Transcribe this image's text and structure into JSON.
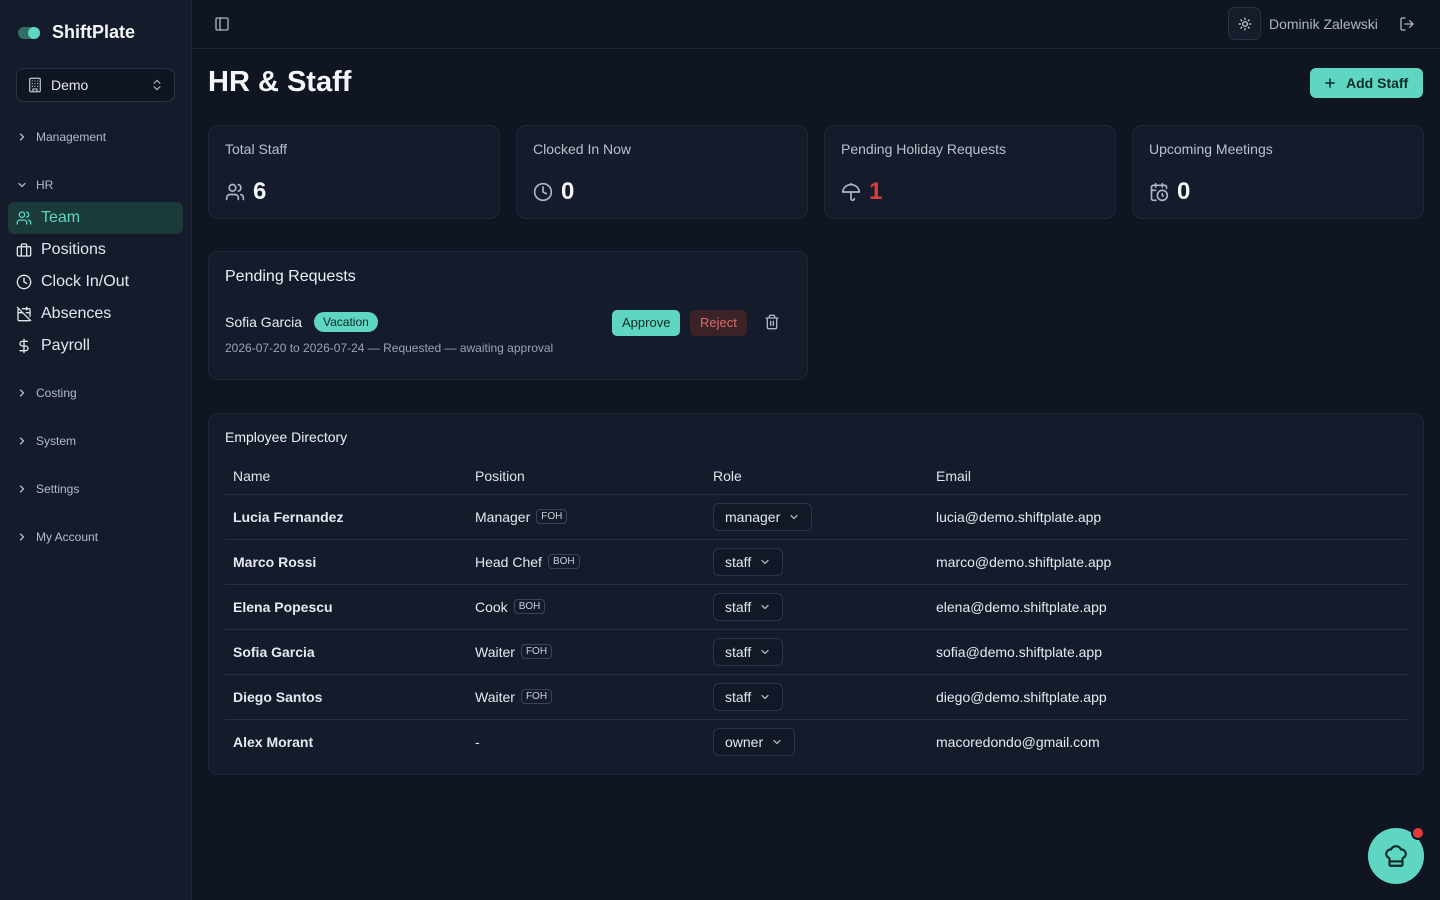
{
  "app": {
    "name": "ShiftPlate"
  },
  "org_select": {
    "value": "Demo"
  },
  "sidebar": {
    "groups": [
      {
        "label": "Management",
        "expanded": false
      },
      {
        "label": "HR",
        "expanded": true
      },
      {
        "label": "Costing",
        "expanded": false
      },
      {
        "label": "System",
        "expanded": false
      },
      {
        "label": "Settings",
        "expanded": false
      },
      {
        "label": "My Account",
        "expanded": false
      }
    ],
    "hr_items": [
      {
        "label": "Team",
        "icon": "users-icon",
        "active": true
      },
      {
        "label": "Positions",
        "icon": "briefcase-icon"
      },
      {
        "label": "Clock In/Out",
        "icon": "clock-icon"
      },
      {
        "label": "Absences",
        "icon": "calendar-off-icon"
      },
      {
        "label": "Payroll",
        "icon": "dollar-icon"
      }
    ]
  },
  "topbar": {
    "user_name": "Dominik Zalewski"
  },
  "page": {
    "title": "HR & Staff",
    "add_button": "Add Staff"
  },
  "stats": [
    {
      "title": "Total Staff",
      "value": "6",
      "icon": "users-icon"
    },
    {
      "title": "Clocked In Now",
      "value": "0",
      "icon": "clock-icon"
    },
    {
      "title": "Pending Holiday Requests",
      "value": "1",
      "icon": "umbrella-icon",
      "color": "#e03b3b"
    },
    {
      "title": "Upcoming Meetings",
      "value": "0",
      "icon": "calendar-clock-icon"
    }
  ],
  "pending": {
    "title": "Pending Requests",
    "request": {
      "name": "Sofia Garcia",
      "type": "Vacation",
      "meta": "2026-07-20 to 2026-07-24 — Requested — awaiting approval",
      "approve": "Approve",
      "reject": "Reject"
    }
  },
  "directory": {
    "title": "Employee Directory",
    "columns": [
      "Name",
      "Position",
      "Role",
      "Email"
    ],
    "rows": [
      {
        "name": "Lucia Fernandez",
        "position": "Manager",
        "tag": "FOH",
        "role": "manager",
        "email": "lucia@demo.shiftplate.app"
      },
      {
        "name": "Marco Rossi",
        "position": "Head Chef",
        "tag": "BOH",
        "role": "staff",
        "email": "marco@demo.shiftplate.app"
      },
      {
        "name": "Elena Popescu",
        "position": "Cook",
        "tag": "BOH",
        "role": "staff",
        "email": "elena@demo.shiftplate.app"
      },
      {
        "name": "Sofia Garcia",
        "position": "Waiter",
        "tag": "FOH",
        "role": "staff",
        "email": "sofia@demo.shiftplate.app"
      },
      {
        "name": "Diego Santos",
        "position": "Waiter",
        "tag": "FOH",
        "role": "staff",
        "email": "diego@demo.shiftplate.app"
      },
      {
        "name": "Alex Morant",
        "position": "-",
        "tag": "",
        "role": "owner",
        "email": "macoredondo@gmail.com"
      }
    ]
  },
  "colors": {
    "accent": "#5ed6c2",
    "danger": "#e03b3b",
    "background": "#0f1521",
    "card": "#141c2b"
  }
}
